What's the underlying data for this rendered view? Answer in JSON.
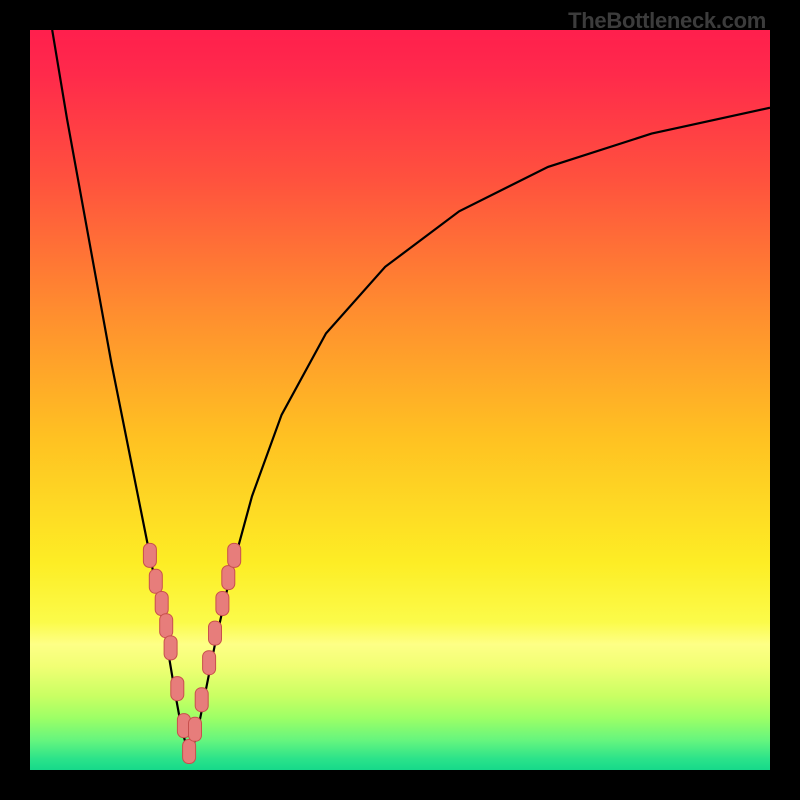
{
  "watermark": "TheBottleneck.com",
  "colors": {
    "black": "#000000",
    "curve": "#000000",
    "marker_fill": "#e77d7b",
    "marker_stroke": "#c84f4d",
    "gradient_stops": [
      {
        "offset": 0.0,
        "color": "#ff1f4d"
      },
      {
        "offset": 0.06,
        "color": "#ff2a4b"
      },
      {
        "offset": 0.2,
        "color": "#ff513e"
      },
      {
        "offset": 0.38,
        "color": "#ff8d2f"
      },
      {
        "offset": 0.55,
        "color": "#ffc122"
      },
      {
        "offset": 0.72,
        "color": "#fded25"
      },
      {
        "offset": 0.8,
        "color": "#fbfb4a"
      },
      {
        "offset": 0.83,
        "color": "#feff86"
      },
      {
        "offset": 0.86,
        "color": "#f1ff74"
      },
      {
        "offset": 0.9,
        "color": "#c9ff63"
      },
      {
        "offset": 0.93,
        "color": "#9cff66"
      },
      {
        "offset": 0.96,
        "color": "#65f57e"
      },
      {
        "offset": 0.985,
        "color": "#2be38a"
      },
      {
        "offset": 1.0,
        "color": "#16d98a"
      }
    ]
  },
  "chart_data": {
    "type": "line",
    "title": "",
    "xlabel": "",
    "ylabel": "",
    "xlim": [
      0,
      100
    ],
    "ylim": [
      0,
      100
    ],
    "vertex_x": 21.5,
    "series": [
      {
        "name": "bottleneck-curve",
        "x": [
          3.0,
          5.0,
          7.0,
          9.0,
          11.0,
          13.0,
          15.0,
          17.0,
          18.5,
          19.5,
          20.5,
          21.5,
          22.5,
          23.5,
          25.0,
          27.0,
          30.0,
          34.0,
          40.0,
          48.0,
          58.0,
          70.0,
          84.0,
          100.0
        ],
        "y": [
          100.0,
          88.0,
          77.0,
          66.0,
          55.0,
          45.0,
          35.0,
          25.0,
          17.0,
          11.0,
          5.5,
          2.0,
          4.5,
          9.5,
          17.0,
          26.0,
          37.0,
          48.0,
          59.0,
          68.0,
          75.5,
          81.5,
          86.0,
          89.5
        ]
      }
    ],
    "markers": {
      "name": "highlighted-band",
      "x": [
        16.2,
        17.0,
        17.8,
        18.4,
        19.0,
        19.9,
        20.8,
        21.5,
        22.3,
        23.2,
        24.2,
        25.0,
        26.0,
        26.8,
        27.6
      ],
      "y": [
        29.0,
        25.5,
        22.5,
        19.5,
        16.5,
        11.0,
        6.0,
        2.5,
        5.5,
        9.5,
        14.5,
        18.5,
        22.5,
        26.0,
        29.0
      ]
    }
  }
}
